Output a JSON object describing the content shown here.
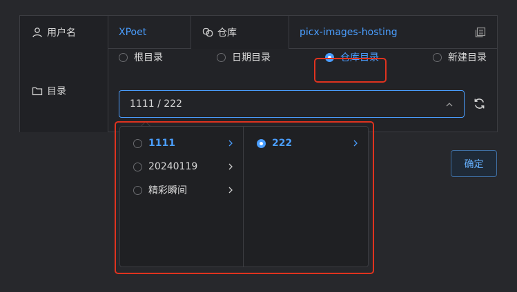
{
  "info": {
    "username_label": "用户名",
    "username_value": "XPoet",
    "repo_label": "仓库",
    "repo_value": "picx-images-hosting",
    "dir_label": "目录"
  },
  "dir_modes": [
    {
      "label": "根目录",
      "selected": false
    },
    {
      "label": "日期目录",
      "selected": false
    },
    {
      "label": "仓库目录",
      "selected": true
    },
    {
      "label": "新建目录",
      "selected": false
    }
  ],
  "cascader": {
    "value": "1111 / 222",
    "columns": [
      [
        {
          "label": "1111",
          "selected": true
        },
        {
          "label": "20240119",
          "selected": false
        },
        {
          "label": "精彩瞬间",
          "selected": false
        }
      ],
      [
        {
          "label": "222",
          "selected": true
        }
      ]
    ]
  },
  "confirm_label": "确定",
  "colors": {
    "accent": "#4a9eff",
    "highlight": "#e0331f",
    "background": "#27282c"
  },
  "icons": [
    "user-icon",
    "repo-icon",
    "copy-icon",
    "folder-icon",
    "chevron-up-icon",
    "refresh-icon",
    "chevron-right-icon"
  ]
}
